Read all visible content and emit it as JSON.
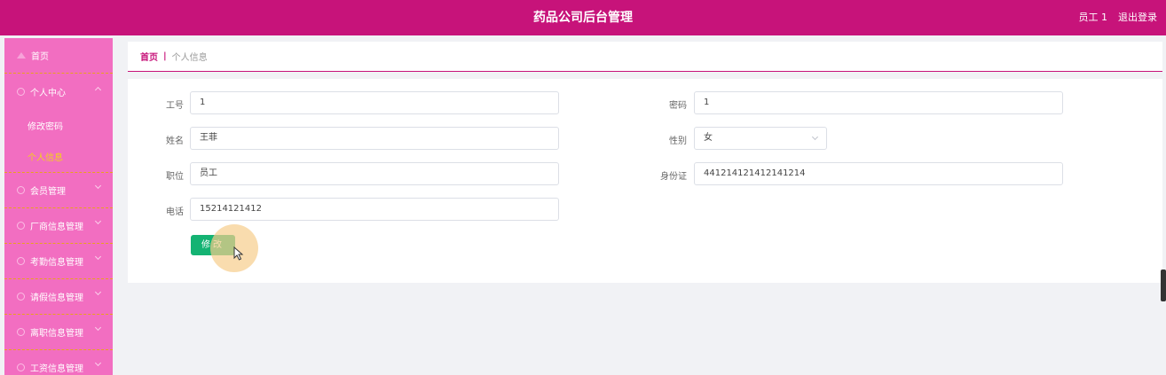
{
  "header": {
    "title": "药品公司后台管理",
    "user": "员工 1",
    "logout": "退出登录"
  },
  "sidebar": {
    "home": "首页",
    "personal_center": "个人中心",
    "sub_change_password": "修改密码",
    "sub_personal_info": "个人信息",
    "member_mgmt": "会员管理",
    "vendor_mgmt": "厂商信息管理",
    "attendance_mgmt": "考勤信息管理",
    "leave_mgmt": "请假信息管理",
    "resign_mgmt": "离职信息管理",
    "salary_mgmt": "工资信息管理"
  },
  "breadcrumb": {
    "home": "首页",
    "separator": "|",
    "current": "个人信息"
  },
  "form": {
    "job_no_label": "工号",
    "job_no": "1",
    "password_label": "密码",
    "password": "1",
    "name_label": "姓名",
    "name": "王菲",
    "gender_label": "性别",
    "gender": "女",
    "position_label": "职位",
    "position": "员工",
    "id_card_label": "身份证",
    "id_card": "441214121412141214",
    "phone_label": "电话",
    "phone": "15214121412",
    "submit": "修改"
  },
  "colors": {
    "primary": "#c7137a",
    "sidebar": "#f26ec1",
    "accent_active": "#f4d11a",
    "button": "#14b373"
  }
}
